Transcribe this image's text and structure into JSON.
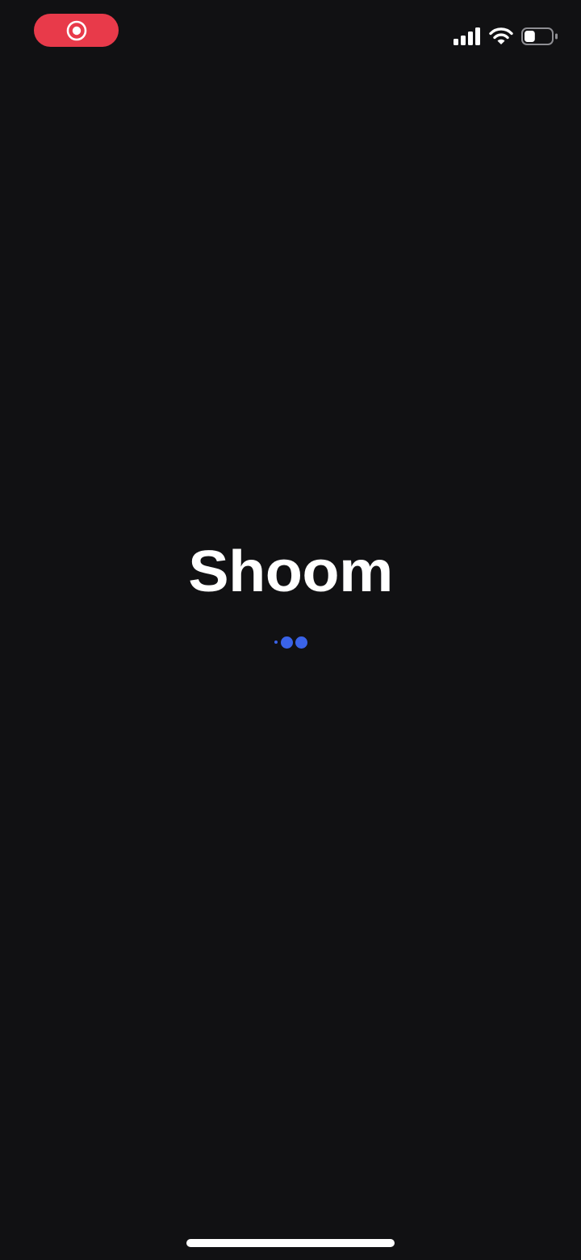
{
  "app": {
    "title": "Shoom"
  },
  "status_bar": {
    "icons": [
      "record-icon",
      "cellular-signal-icon",
      "wifi-icon",
      "battery-icon"
    ],
    "battery_level": 0.4
  },
  "loader": {
    "state": "loading",
    "dots": 3
  },
  "colors": {
    "background": "#111113",
    "title": "#ffffff",
    "accent": "#3a63e8",
    "recording": "#e83a4a"
  }
}
